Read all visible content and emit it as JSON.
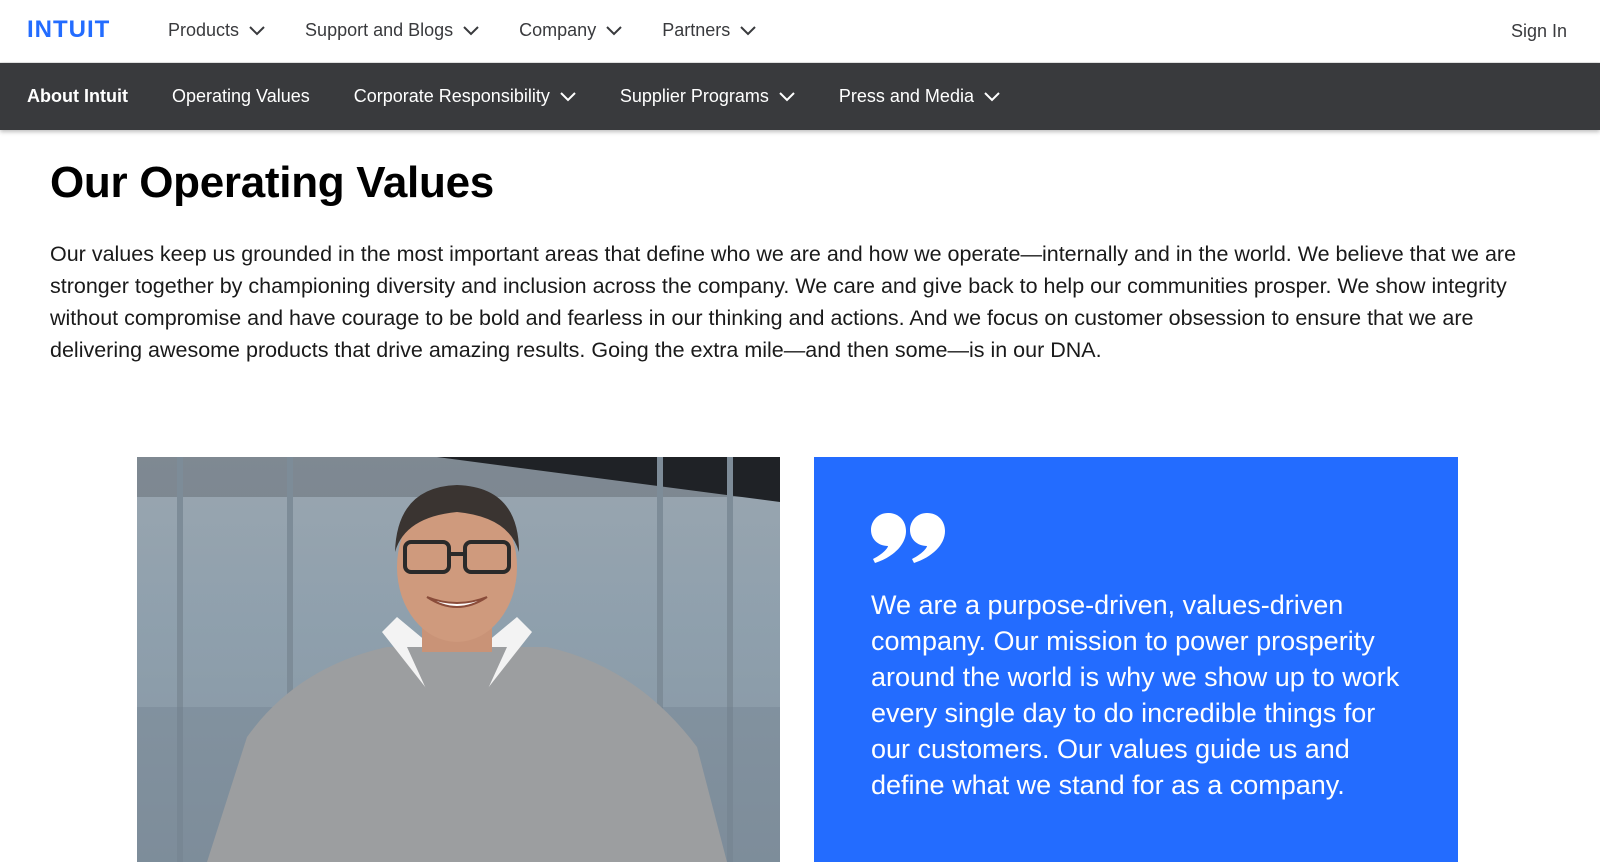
{
  "top_nav": {
    "brand": "INTUIT",
    "menu": [
      {
        "label": "Products"
      },
      {
        "label": "Support and Blogs"
      },
      {
        "label": "Company"
      },
      {
        "label": "Partners"
      }
    ],
    "sign_in": "Sign In"
  },
  "sub_nav": {
    "items": [
      {
        "label": "About Intuit",
        "active": true,
        "dropdown": false
      },
      {
        "label": "Operating Values",
        "active": false,
        "dropdown": false
      },
      {
        "label": "Corporate Responsibility",
        "active": false,
        "dropdown": true
      },
      {
        "label": "Supplier Programs",
        "active": false,
        "dropdown": true
      },
      {
        "label": "Press and Media",
        "active": false,
        "dropdown": true
      }
    ]
  },
  "main": {
    "title": "Our Operating Values",
    "intro": "Our values keep us grounded in the most important areas that define who we are and how we operate—internally and in the world. We believe that we are stronger together by championing diversity and inclusion across the company. We care and give back to help our communities prosper. We show integrity without compromise and have courage to be bold and fearless in our thinking and actions. And we focus on customer obsession to ensure that we are delivering awesome products that drive amazing results. Going the extra mile—and then some—is in our DNA."
  },
  "quote": {
    "text": "We are a purpose-driven, values-driven company. Our mission to power prosperity around the world is why we show up to work every single day to do incredible things for our customers. Our values guide us and define what we stand for as a company."
  },
  "icons": {
    "chevron": "chevron-down-icon",
    "quote": "quote-mark-icon",
    "photo": "person-photo"
  },
  "colors": {
    "brand_blue": "#236cff",
    "subnav_bg": "#393a3d",
    "text_dark": "#393a3d"
  }
}
